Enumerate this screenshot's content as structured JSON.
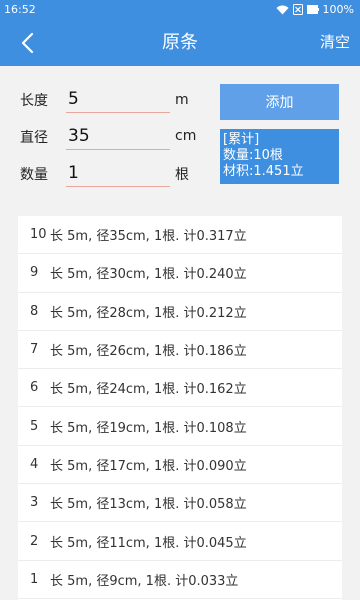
{
  "status": {
    "time": "16:52",
    "battery": "100%"
  },
  "header": {
    "title": "原条",
    "clear_label": "清空"
  },
  "form": {
    "length": {
      "label": "长度",
      "value": "5",
      "unit": "m"
    },
    "diameter": {
      "label": "直径",
      "value": "35",
      "unit": "cm"
    },
    "quantity": {
      "label": "数量",
      "value": "1",
      "unit": "根"
    },
    "add_label": "添加"
  },
  "summary": {
    "heading": "[累计]",
    "count_line": "数量:10根",
    "volume_line": "材积:1.451立"
  },
  "records": [
    {
      "index": "10",
      "text": "长 5m, 径35cm, 1根. 计0.317立"
    },
    {
      "index": "9",
      "text": "长 5m, 径30cm, 1根. 计0.240立"
    },
    {
      "index": "8",
      "text": "长 5m, 径28cm, 1根. 计0.212立"
    },
    {
      "index": "7",
      "text": "长 5m, 径26cm, 1根. 计0.186立"
    },
    {
      "index": "6",
      "text": "长 5m, 径24cm, 1根. 计0.162立"
    },
    {
      "index": "5",
      "text": "长 5m, 径19cm, 1根. 计0.108立"
    },
    {
      "index": "4",
      "text": "长 5m, 径17cm, 1根. 计0.090立"
    },
    {
      "index": "3",
      "text": "长 5m, 径13cm, 1根. 计0.058立"
    },
    {
      "index": "2",
      "text": "长 5m, 径11cm, 1根. 计0.045立"
    },
    {
      "index": "1",
      "text": "长 5m, 径9cm, 1根. 计0.033立"
    }
  ]
}
